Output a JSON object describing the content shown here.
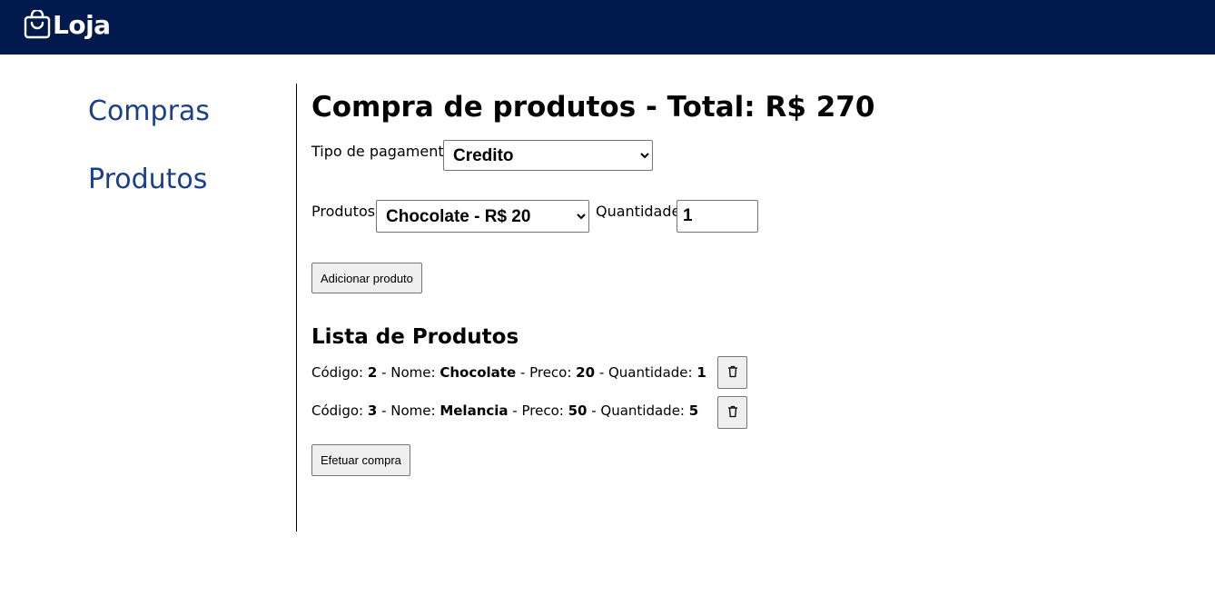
{
  "header": {
    "brand": "Loja",
    "brand_icon": "shopping-bag-icon",
    "background": "#001a4d"
  },
  "sidebar": {
    "items": [
      {
        "label": "Compras"
      },
      {
        "label": "Produtos"
      }
    ],
    "link_color": "#1c3f8c"
  },
  "main": {
    "title": "Compra de produtos - Total: R$ 270",
    "payment": {
      "label": "Tipo de pagamento",
      "selected": "Credito"
    },
    "product": {
      "label": "Produtos",
      "selected": "Chocolate - R$ 20"
    },
    "quantity": {
      "label": "Quantidade",
      "value": "1"
    },
    "add_button": "Adicionar produto",
    "list_title": "Lista de Produtos",
    "list_labels": {
      "code": "Código: ",
      "name": " - Nome: ",
      "price": " - Preco: ",
      "quantity": " - Quantidade: "
    },
    "items": [
      {
        "code": "2",
        "name": "Chocolate",
        "price": "20",
        "quantity": "1"
      },
      {
        "code": "3",
        "name": "Melancia",
        "price": "50",
        "quantity": "5"
      }
    ],
    "delete_icon": "trash-icon",
    "checkout_button": "Efetuar compra"
  }
}
